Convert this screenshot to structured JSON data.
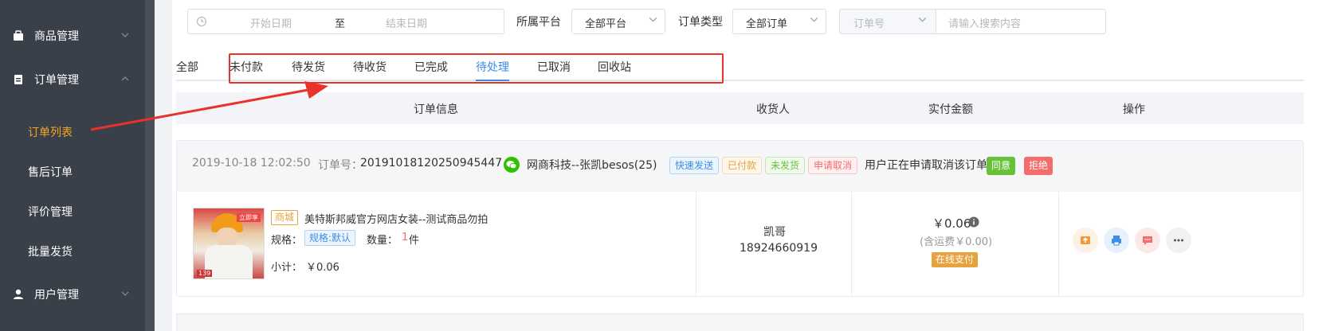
{
  "sidebar": {
    "menus": [
      {
        "label": "商品管理",
        "icon": "bag-icon"
      },
      {
        "label": "订单管理",
        "icon": "clipboard-icon"
      },
      {
        "label": "用户管理",
        "icon": "user-icon"
      }
    ],
    "order_submenu": [
      "订单列表",
      "售后订单",
      "评价管理",
      "批量发货"
    ]
  },
  "filters": {
    "start_date_placeholder": "开始日期",
    "date_separator": "至",
    "end_date_placeholder": "结束日期",
    "platform_label": "所属平台",
    "platform_value": "全部平台",
    "order_type_label": "订单类型",
    "order_type_value": "全部订单",
    "search_field_placeholder": "订单号",
    "search_placeholder": "请输入搜索内容"
  },
  "tabs": [
    "全部",
    "未付款",
    "待发货",
    "待收货",
    "已完成",
    "待处理",
    "已取消",
    "回收站"
  ],
  "active_tab": "待处理",
  "table_headers": [
    "订单信息",
    "收货人",
    "实付金额",
    "操作"
  ],
  "order": {
    "datetime": "2019-10-18 12:02:50",
    "order_no_label": "订单号：",
    "order_no": "20191018120250945447",
    "shop": "网商科技--张凯besos(25)",
    "tags": [
      "快速发送",
      "已付款",
      "未发货",
      "申请取消"
    ],
    "cancel_notice": "用户正在申请取消该订单",
    "agree_label": "同意",
    "reject_label": "拒绝",
    "product": {
      "store_badge": "商城",
      "title": "美特斯邦威官方网店女装--测试商品勿拍",
      "spec_label": "规格：",
      "spec_value": "规格:默认",
      "qty_label": "数量：",
      "qty": "1",
      "qty_unit": "件",
      "subtotal_label": "小计：",
      "subtotal": "￥0.06",
      "image_badge": "立即享",
      "image_price": "139"
    },
    "consignee": {
      "name": "凯哥",
      "phone": "18924660919"
    },
    "amount": "￥0.06",
    "shipping_note": "(含运费￥0.00)",
    "pay_method": "在线支付"
  },
  "colors": {
    "sidebar_bg": "#3a4049",
    "active_submenu": "#f5a623",
    "accent_blue": "#3a8ee6",
    "callout_red": "#e8322c",
    "agree_green": "#67c23a",
    "reject_red": "#f56c6c"
  }
}
